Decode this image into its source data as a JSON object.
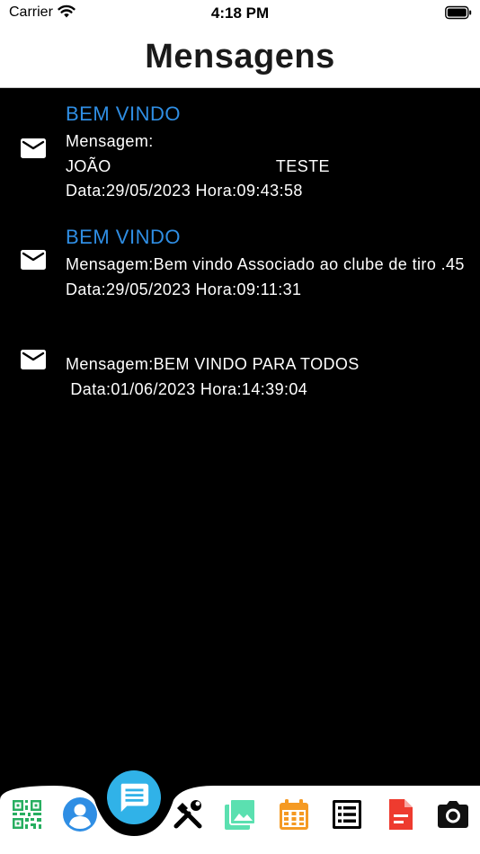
{
  "status": {
    "carrier": "Carrier",
    "time": "4:18 PM"
  },
  "header": {
    "title": "Mensagens"
  },
  "messages": [
    {
      "subject": "BEM VINDO",
      "body": "Mensagem:\nJOÃO                                  TESTE\nData:29/05/2023 Hora:09:43:58"
    },
    {
      "subject": "BEM VINDO",
      "body": "Mensagem:Bem vindo Associado ao clube de tiro .45 Data:29/05/2023 Hora:09:11:31"
    },
    {
      "subject": "",
      "body": "Mensagem:BEM VINDO PARA TODOS\n Data:01/06/2023 Hora:14:39:04"
    }
  ],
  "icons": {
    "message": "mail-icon",
    "tabs": [
      "qr-code-icon",
      "profile-icon",
      "chat-icon",
      "tools-icon",
      "gallery-icon",
      "calendar-icon",
      "list-icon",
      "document-icon",
      "camera-icon"
    ]
  },
  "colors": {
    "accent": "#2f8ee4",
    "active_tab": "#30b2e8",
    "background": "#000000",
    "qr": "#27ae60",
    "profile": "#2f8ee4",
    "gallery": "#5be0b0",
    "calendar": "#f59a23",
    "document": "#ee3b2f"
  }
}
